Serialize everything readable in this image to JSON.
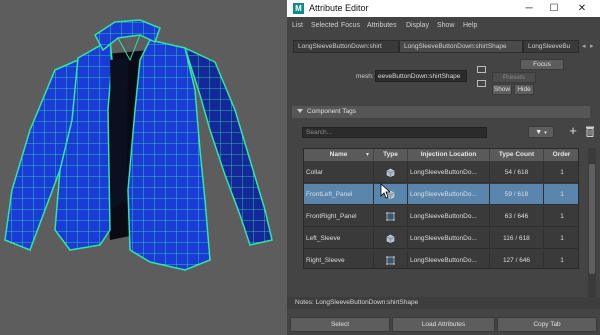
{
  "window": {
    "title": "Attribute Editor",
    "app_icon": "M"
  },
  "menu": [
    "List",
    "Selected",
    "Focus",
    "Attributes",
    "Display",
    "Show",
    "Help"
  ],
  "tabs": [
    "LongSleeveButtonDown:shirt",
    "LongSleeveButtonDown:shirtShape",
    "LongSleeveBu"
  ],
  "mesh": {
    "label": "mesh:",
    "value": "eeveButtonDown:shirtShape",
    "focus": "Focus",
    "presets": "Presets",
    "show": "Show",
    "hide": "Hide"
  },
  "section": {
    "title": "Component Tags"
  },
  "search": {
    "placeholder": "Search..."
  },
  "table": {
    "columns": [
      "Name",
      "Type",
      "Injection Location",
      "Type Count",
      "Order"
    ],
    "rows": [
      {
        "name": "Collar",
        "type": "vertex",
        "injection": "LongSleeveButtonDo...",
        "count": "54 / 618",
        "order": "1"
      },
      {
        "name": "FrontLeft_Panel",
        "type": "vertex",
        "injection": "LongSleeveButtonDo...",
        "count": "59 / 618",
        "order": "1"
      },
      {
        "name": "FrontRight_Panel",
        "type": "face",
        "injection": "LongSleeveButtonDo...",
        "count": "63 / 646",
        "order": "1"
      },
      {
        "name": "Left_Sleeve",
        "type": "vertex",
        "injection": "LongSleeveButtonDo...",
        "count": "116 / 618",
        "order": "1"
      },
      {
        "name": "Right_Sleeve",
        "type": "face",
        "injection": "LongSleeveButtonDo...",
        "count": "127 / 646",
        "order": "1"
      }
    ],
    "selected_row": 1
  },
  "notes": {
    "label": "Notes:  LongSleeveButtonDown:shirtShape"
  },
  "bottom_buttons": {
    "select": "Select",
    "load": "Load Attributes",
    "copy": "Copy Tab"
  },
  "colors": {
    "wire": "#2ee6a6",
    "shirt": "#1b3bd6",
    "selection": "#5a86ad"
  }
}
